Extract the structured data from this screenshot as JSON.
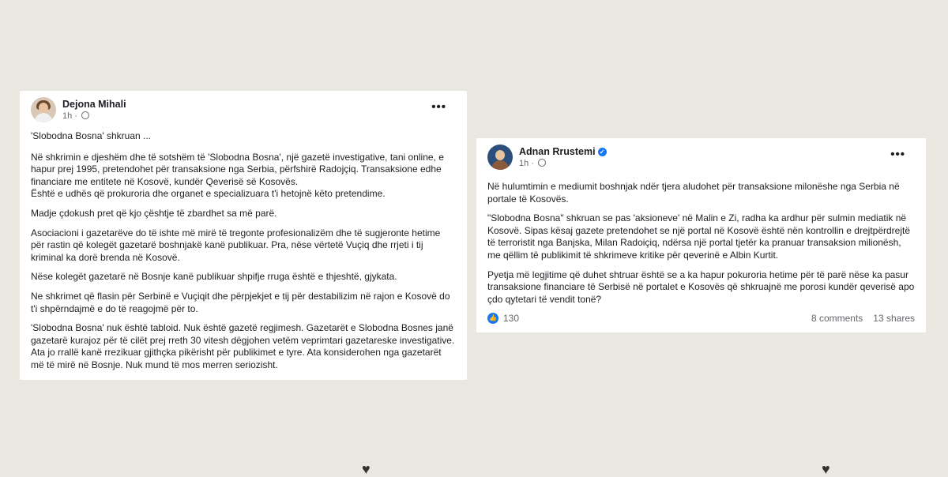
{
  "post_left": {
    "author": "Dejona Mihali",
    "time": "1h",
    "paragraphs": [
      "'Slobodna Bosna' shkruan ...",
      "Në shkrimin e djeshëm dhe të sotshëm të 'Slobodna Bosna', një gazetë investigative, tani online, e hapur prej 1995, pretendohet për transaksione nga Serbia, përfshirë Radojçiq.  Transaksione edhe financiare me entitete në Kosovë, kundër Qeverisë së Kosovës.\nËshtë e udhës që prokuroria dhe organet e specializuara t'i hetojnë këto pretendime.",
      "Madje çdokush pret që kjo çështje të zbardhet sa më parë.",
      "Asociacioni i gazetarëve do të ishte më mirë të tregonte profesionalizëm dhe të sugjeronte hetime për rastin që kolegët gazetarë boshnjakë kanë publikuar. Pra, nëse vërtetë Vuçiq dhe rrjeti i tij kriminal ka dorë brenda në Kosovë.",
      "Nëse kolegët gazetarë në Bosnje kanë publikuar shpifje rruga është e thjeshtë, gjykata.",
      "Ne shkrimet që flasin për Serbinë e Vuçiqit dhe përpjekjet e tij për destabilizim në rajon e Kosovë do t'i shpërndajmë e do të reagojmë për to.",
      "'Slobodna Bosna' nuk është tabloid. Nuk është gazetë regjimesh. Gazetarët e Slobodna Bosnes janë gazetarë kurajoz për të cilët prej rreth 30 vitesh dëgjohen vetëm veprimtari gazetareske investigative. Ata jo rrallë kanë rrezikuar gjithçka pikërisht për publikimet e tyre. Ata konsiderohen nga gazetarët më të mirë në Bosnje. Nuk mund të mos merren seriozisht."
    ]
  },
  "post_right": {
    "author": "Adnan Rrustemi",
    "time": "1h",
    "paragraphs": [
      "Në hulumtimin e mediumit boshnjak ndër tjera aludohet për transaksione milonëshe nga Serbia në portale të Kosovës.",
      "\"Slobodna Bosna\" shkruan se pas 'aksioneve' në Malin e Zi, radha ka ardhur për sulmin mediatik në Kosovë. Sipas kësaj gazete pretendohet se një portal në Kosovë është nën kontrollin e drejtpërdrejtë të terroristit nga Banjska, Milan Radoiçiq, ndërsa një portal tjetër ka pranuar transaksion milionësh, me qëllim të publikimit të shkrimeve kritike për qeverinë e Albin Kurtit.",
      "Pyetja më legjitime që duhet shtruar është se a ka hapur pokuroria hetime për të parë nëse ka pasur transaksione financiare të Serbisë në portalet e Kosovës që shkruajnë me porosi kundër qeverisë apo çdo qytetari të vendit tonë?"
    ],
    "reactions": "130",
    "comments": "8 comments",
    "shares": "13 shares"
  },
  "icons": {
    "more": "more-options-icon",
    "globe": "globe-icon",
    "verified": "verified-badge-icon",
    "like": "like-reaction-icon",
    "heart": "heart-icon"
  },
  "colors": {
    "background": "#e9e7e0",
    "card": "#ffffff",
    "facebook_blue": "#1877f2",
    "meta_gray": "#65676b"
  }
}
